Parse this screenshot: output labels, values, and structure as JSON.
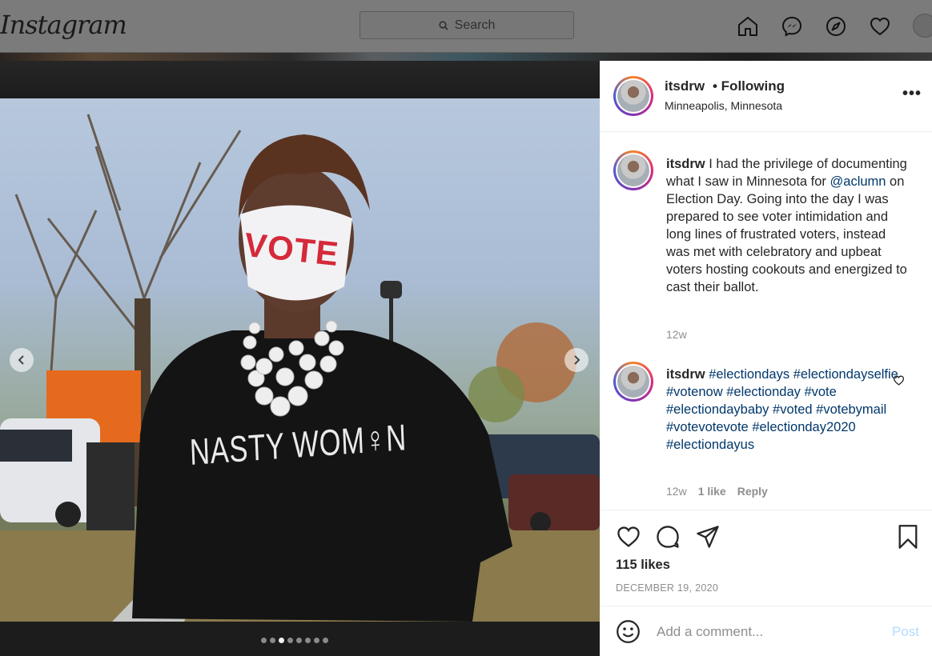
{
  "nav": {
    "logo": "Instagram",
    "search_placeholder": "Search",
    "icons": [
      "home-icon",
      "messenger-icon",
      "explore-icon",
      "activity-heart-icon",
      "profile-avatar"
    ]
  },
  "post": {
    "username": "itsdrw",
    "follow_state": "• Following",
    "location": "Minneapolis, Minnesota",
    "more_label": "•••",
    "carousel": {
      "total": 8,
      "active_index": 3
    },
    "photo_text": {
      "mask": "VOTE",
      "shirt": "NASTY WOM♀N"
    }
  },
  "caption": {
    "username": "itsdrw",
    "text_before": "I had the privilege of documenting what I saw in Minnesota for ",
    "mention": "@aclumn",
    "text_after": " on Election Day. Going into the day I was prepared to see voter intimidation and long lines of frustrated voters, instead was met with celebratory and upbeat voters hosting cookouts and energized to cast their ballot.",
    "time": "12w"
  },
  "comments": [
    {
      "username": "itsdrw",
      "hashtags": "#electiondays #electiondayselfie #votenow #electionday #vote #electiondaybaby #voted #votebymail #votevotevote #electionday2020 #electiondayus",
      "time": "12w",
      "likes": "1 like",
      "reply": "Reply"
    }
  ],
  "engagement": {
    "likes": "115 likes",
    "date": "DECEMBER 19, 2020"
  },
  "add_comment": {
    "placeholder": "Add a comment...",
    "post_label": "Post"
  },
  "colors": {
    "link": "#00376b",
    "post_button_disabled": "#b3dbff",
    "muted": "#8e8e8e"
  }
}
